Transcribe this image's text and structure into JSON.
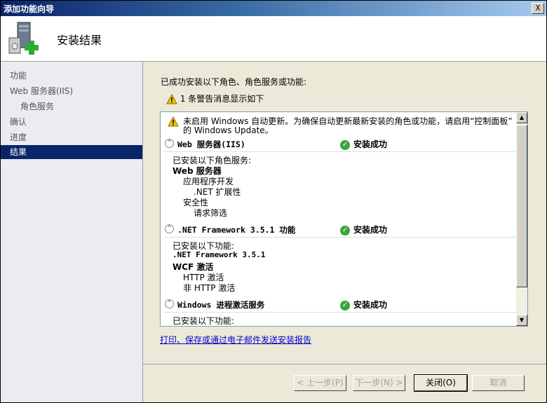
{
  "window": {
    "title": "添加功能向导",
    "close_glyph": "X"
  },
  "header": {
    "title": "安装结果",
    "icon": "server-with-add-icon"
  },
  "nav": {
    "items": [
      {
        "label": "功能",
        "active": false
      },
      {
        "label": "Web 服务器(IIS)",
        "active": false
      },
      {
        "label": "角色服务",
        "active": false
      },
      {
        "label": "确认",
        "active": false
      },
      {
        "label": "进度",
        "active": false
      },
      {
        "label": "结果",
        "active": true
      }
    ]
  },
  "content": {
    "intro": "已成功安装以下角色、角色服务或功能:",
    "warning_summary": "1 条警告消息显示如下",
    "list": {
      "warning_line1": "未启用 Windows 自动更新。为确保自动更新最新安装的角色或功能，请启用“控制面板”",
      "warning_line2": "的 Windows Update。",
      "sections": [
        {
          "name": "Web 服务器(IIS)",
          "status": "安装成功",
          "heading": "已安装以下角色服务:",
          "lines": [
            "Web 服务器",
            "应用程序开发",
            ".NET 扩展性",
            "安全性",
            "请求筛选"
          ]
        },
        {
          "name": ".NET Framework 3.5.1 功能",
          "status": "安装成功",
          "heading": "已安装以下功能:",
          "lines": [
            ".NET Framework 3.5.1",
            "WCF 激活",
            "HTTP 激活",
            "非 HTTP 激活"
          ]
        },
        {
          "name": "Windows 进程激活服务",
          "status": "安装成功",
          "heading": "已安装以下功能:"
        }
      ]
    },
    "report_link": "打印、保存或通过电子邮件发送安装报告"
  },
  "buttons": {
    "prev": "< 上一步(P)",
    "next": "下一步(N) >",
    "close": "关闭(O)",
    "cancel": "取消"
  },
  "colors": {
    "accent": "#0a246a",
    "success": "#3aa63a",
    "warning": "#f5c400",
    "link": "#0000cc"
  }
}
